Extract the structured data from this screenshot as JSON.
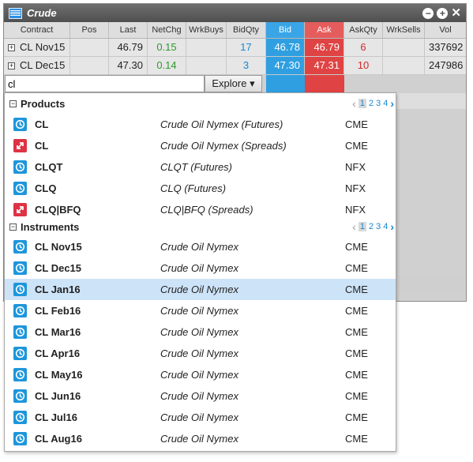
{
  "window": {
    "title": "Crude"
  },
  "grid": {
    "columns": [
      "Contract",
      "Pos",
      "Last",
      "NetChg",
      "WrkBuys",
      "BidQty",
      "Bid",
      "Ask",
      "AskQty",
      "WrkSells",
      "Vol"
    ],
    "rows": [
      {
        "contract": "CL Nov15",
        "pos": "",
        "last": "46.79",
        "netchg": "0.15",
        "wrkbuys": "",
        "bidqty": "17",
        "bid": "46.78",
        "ask": "46.79",
        "askqty": "6",
        "wrksells": "",
        "vol": "337692"
      },
      {
        "contract": "CL Dec15",
        "pos": "",
        "last": "47.30",
        "netchg": "0.14",
        "wrkbuys": "",
        "bidqty": "3",
        "bid": "47.30",
        "ask": "47.31",
        "askqty": "10",
        "wrksells": "",
        "vol": "247986"
      }
    ]
  },
  "search": {
    "value": "cl",
    "explore_label": "Explore ▾"
  },
  "products": {
    "header": "Products",
    "pager": {
      "pages": [
        "1",
        "2",
        "3",
        "4"
      ]
    },
    "items": [
      {
        "name": "CL",
        "desc": "Crude Oil Nymex (Futures)",
        "exchange": "CME",
        "icon": "futures-icon"
      },
      {
        "name": "CL",
        "desc": "Crude Oil Nymex (Spreads)",
        "exchange": "CME",
        "icon": "spread-icon"
      },
      {
        "name": "CLQT",
        "desc": "CLQT (Futures)",
        "exchange": "NFX",
        "icon": "futures-icon"
      },
      {
        "name": "CLQ",
        "desc": "CLQ (Futures)",
        "exchange": "NFX",
        "icon": "futures-icon"
      },
      {
        "name": "CLQ|BFQ",
        "desc": "CLQ|BFQ (Spreads)",
        "exchange": "NFX",
        "icon": "spread-icon"
      }
    ]
  },
  "instruments": {
    "header": "Instruments",
    "pager": {
      "pages": [
        "1",
        "2",
        "3",
        "4"
      ]
    },
    "items": [
      {
        "name": "CL Nov15",
        "desc": "Crude Oil Nymex",
        "exchange": "CME"
      },
      {
        "name": "CL Dec15",
        "desc": "Crude Oil Nymex",
        "exchange": "CME"
      },
      {
        "name": "CL Jan16",
        "desc": "Crude Oil Nymex",
        "exchange": "CME"
      },
      {
        "name": "CL Feb16",
        "desc": "Crude Oil Nymex",
        "exchange": "CME"
      },
      {
        "name": "CL Mar16",
        "desc": "Crude Oil Nymex",
        "exchange": "CME"
      },
      {
        "name": "CL Apr16",
        "desc": "Crude Oil Nymex",
        "exchange": "CME"
      },
      {
        "name": "CL May16",
        "desc": "Crude Oil Nymex",
        "exchange": "CME"
      },
      {
        "name": "CL Jun16",
        "desc": "Crude Oil Nymex",
        "exchange": "CME"
      },
      {
        "name": "CL Jul16",
        "desc": "Crude Oil Nymex",
        "exchange": "CME"
      },
      {
        "name": "CL Aug16",
        "desc": "Crude Oil Nymex",
        "exchange": "CME"
      }
    ]
  },
  "colors": {
    "bid": "#2f9fe2",
    "ask": "#e04343",
    "futures_icon": "#1d96db",
    "spread_icon": "#dd3344",
    "selected_row": "#cde3f8"
  }
}
